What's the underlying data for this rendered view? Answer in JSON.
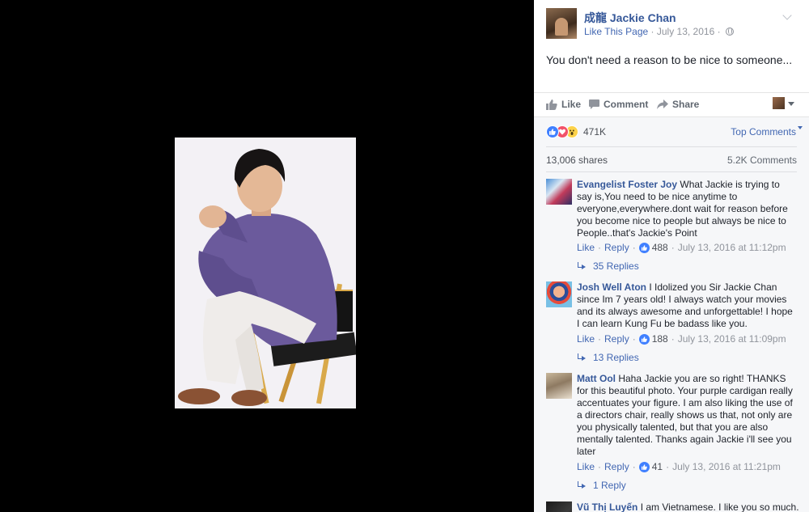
{
  "post": {
    "page_name": "成龍 Jackie Chan",
    "like_page": "Like This Page",
    "date": "July 13, 2016",
    "text": "You don't need a reason to be nice to someone..."
  },
  "actions": {
    "like": "Like",
    "comment": "Comment",
    "share": "Share"
  },
  "stats": {
    "reactions_count": "471K",
    "sort_label": "Top Comments",
    "shares": "13,006 shares",
    "comments": "5.2K Comments"
  },
  "comments": [
    {
      "author": "Evangelist Foster Joy",
      "text": "What Jackie is trying to say is,You need to be nice anytime to everyone,everywhere.dont wait for reason before you become nice to people but always be nice to People..that's Jackie's Point",
      "like": "Like",
      "reply": "Reply",
      "likes": "488",
      "time": "July 13, 2016 at 11:12pm",
      "replies": "35 Replies"
    },
    {
      "author": "Josh Well Aton",
      "text": "I Idolized you Sir Jackie Chan since Im 7 years old! I always watch your movies and its always awesome and unforgettable! I hope I can learn Kung Fu be badass like you.",
      "like": "Like",
      "reply": "Reply",
      "likes": "188",
      "time": "July 13, 2016 at 11:09pm",
      "replies": "13 Replies"
    },
    {
      "author": "Matt Ool",
      "text": "Haha Jackie you are so right! THANKS for this beautiful photo. Your purple cardigan really accentuates your figure. I am also liking the use of a directors chair, really shows us that, not only are you physically talented, but that you are also mentally talented. Thanks again Jackie i'll see you later",
      "like": "Like",
      "reply": "Reply",
      "likes": "41",
      "time": "July 13, 2016 at 11:21pm",
      "replies": "1 Reply"
    },
    {
      "author": "Vũ Thị Luyến",
      "text": "I am Vietnamese. I like you so much."
    }
  ],
  "colors": {
    "link": "#365899",
    "accent": "#4267b2",
    "viewer_bg": "#000000"
  }
}
